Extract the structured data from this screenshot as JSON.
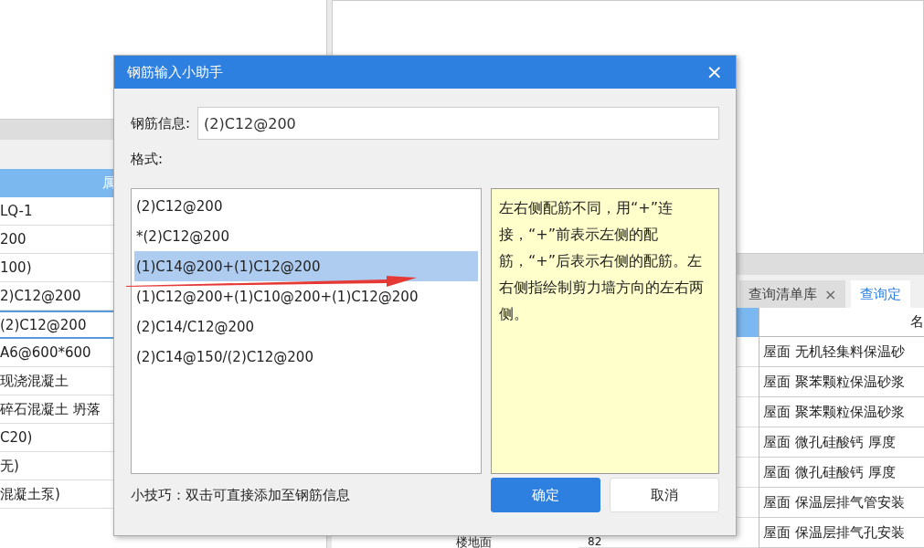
{
  "left_table": {
    "header": "属",
    "rows": [
      {
        "text": "LQ-1",
        "selected": false
      },
      {
        "text": "200",
        "selected": false
      },
      {
        "text": "100)",
        "selected": false
      },
      {
        "text": "2)C12@200",
        "selected": false
      },
      {
        "text": "(2)C12@200",
        "selected": true
      },
      {
        "text": "A6@600*600",
        "selected": false
      },
      {
        "text": "现浇混凝土",
        "selected": false
      },
      {
        "text": "碎石混凝土 坍落",
        "selected": false
      },
      {
        "text": "C20)",
        "selected": false
      },
      {
        "text": "无)",
        "selected": false
      },
      {
        "text": "混凝土泵)",
        "selected": false
      }
    ]
  },
  "lower_left": {
    "cell": "楼地面"
  },
  "tabs": [
    {
      "label": "查询清单库",
      "selected": false,
      "close": "×"
    },
    {
      "label": "查询定",
      "selected": true
    }
  ],
  "right_table": {
    "column": "名",
    "rows": [
      "屋面 无机轻集料保温砂",
      "屋面 聚苯颗粒保温砂浆",
      "屋面 聚苯颗粒保温砂浆",
      "屋面 微孔硅酸钙 厚度",
      "屋面 微孔硅酸钙 厚度",
      "屋面 保温层排气管安装",
      "屋面 保温层排气孔安装"
    ],
    "last_row_number": "82"
  },
  "dialog": {
    "title": "钢筋输入小助手",
    "close": "×",
    "field_label": "钢筋信息:",
    "field_value": "(2)C12@200",
    "format_label": "格式:",
    "formats": [
      {
        "text": "(2)C12@200",
        "selected": false
      },
      {
        "text": "*(2)C12@200",
        "selected": false
      },
      {
        "text": "(1)C14@200+(1)C12@200",
        "selected": true
      },
      {
        "text": "(1)C12@200+(1)C10@200+(1)C12@200",
        "selected": false
      },
      {
        "text": "(2)C14/C12@200",
        "selected": false
      },
      {
        "text": "(2)C14@150/(2)C12@200",
        "selected": false
      }
    ],
    "description": "左右侧配筋不同，用“+”连接，“+”前表示左侧的配筋，“+”后表示右侧的配筋。左右侧指绘制剪力墙方向的左右两侧。",
    "tip": "小技巧：双击可直接添加至钢筋信息",
    "ok": "确定",
    "cancel": "取消"
  }
}
